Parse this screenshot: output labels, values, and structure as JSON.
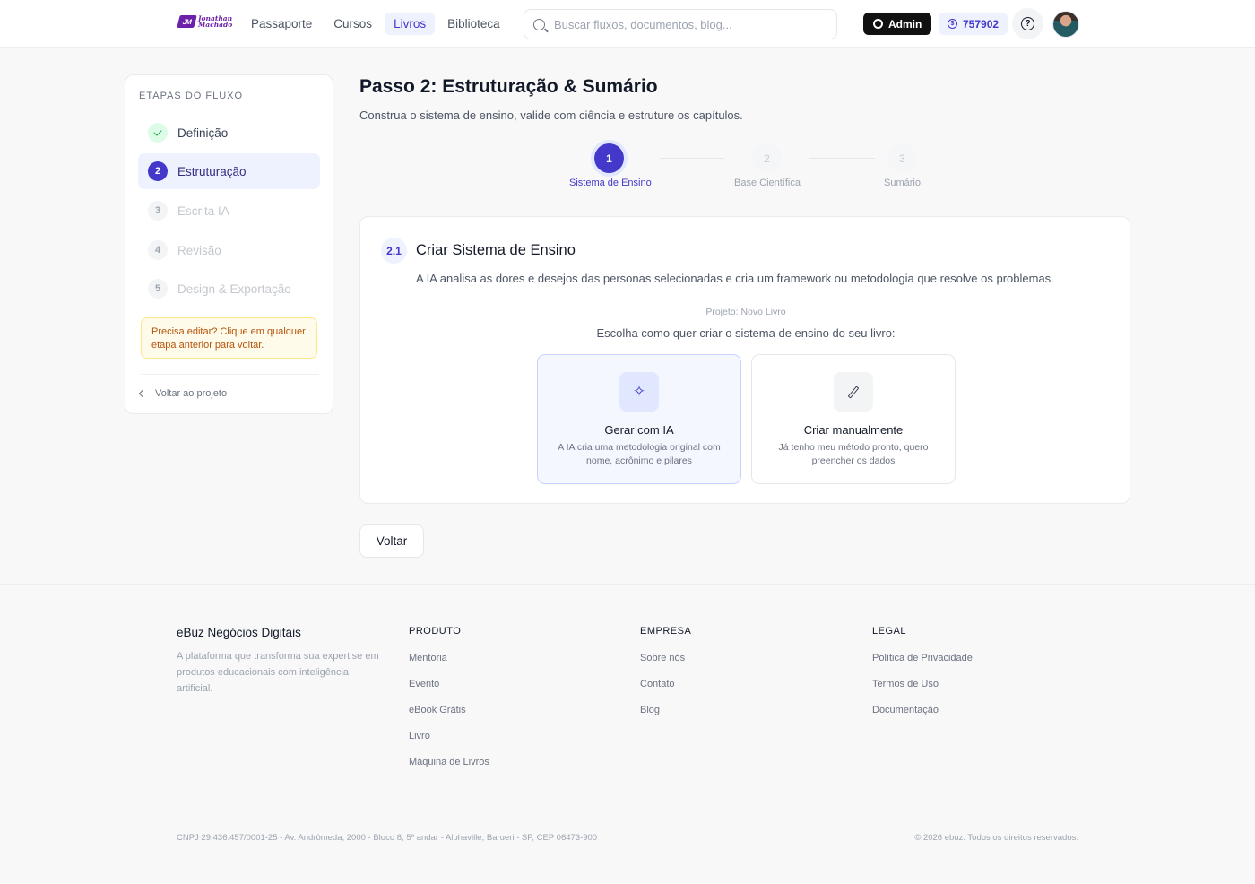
{
  "header": {
    "logo_mark": "JM",
    "logo_text_line1": "Jonathan",
    "logo_text_line2": "Machado",
    "nav": [
      {
        "label": "Passaporte",
        "active": false
      },
      {
        "label": "Cursos",
        "active": false
      },
      {
        "label": "Livros",
        "active": true
      },
      {
        "label": "Biblioteca",
        "active": false
      }
    ],
    "search_placeholder": "Buscar fluxos, documentos, blog...",
    "admin_label": "Admin",
    "credits": "757902",
    "help_glyph": "?"
  },
  "sidebar": {
    "heading": "ETAPAS DO FLUXO",
    "steps": [
      {
        "number": "1",
        "label": "Definição",
        "state": "done"
      },
      {
        "number": "2",
        "label": "Estruturação",
        "state": "active"
      },
      {
        "number": "3",
        "label": "Escrita IA",
        "state": "locked"
      },
      {
        "number": "4",
        "label": "Revisão",
        "state": "locked"
      },
      {
        "number": "5",
        "label": "Design & Exportação",
        "state": "locked"
      }
    ],
    "edit_note": "Precisa editar? Clique em qualquer etapa anterior para voltar.",
    "back_label": "Voltar ao projeto"
  },
  "main": {
    "title": "Passo 2: Estruturação & Sumário",
    "subtitle": "Construa o sistema de ensino, valide com ciência e estruture os capítulos.",
    "stepper": [
      {
        "number": "1",
        "label": "Sistema de Ensino",
        "current": true
      },
      {
        "number": "2",
        "label": "Base Científica",
        "current": false
      },
      {
        "number": "3",
        "label": "Sumário",
        "current": false
      }
    ],
    "section": {
      "badge": "2.1",
      "title": "Criar Sistema de Ensino",
      "description": "A IA analisa as dores e desejos das personas selecionadas e cria um framework ou metodologia que resolve os problemas.",
      "project_line": "Projeto: Novo Livro",
      "choose_line": "Escolha como quer criar o sistema de ensino do seu livro:",
      "options": [
        {
          "icon": "sparkle-icon",
          "glyph": "✧",
          "title": "Gerar com IA",
          "description": "A IA cria uma metodologia original com nome, acrônimo e pilares"
        },
        {
          "icon": "pencil-icon",
          "title": "Criar manualmente",
          "description": "Já tenho meu método pronto, quero preencher os dados"
        }
      ]
    },
    "back_button": "Voltar"
  },
  "footer": {
    "brand": "eBuz Negócios Digitais",
    "description": "A plataforma que transforma sua expertise em produtos educacionais com inteligência artificial.",
    "columns": [
      {
        "heading": "PRODUTO",
        "links": [
          "Mentoria",
          "Evento",
          "eBook Grátis",
          "Livro",
          "Máquina de Livros"
        ]
      },
      {
        "heading": "EMPRESA",
        "links": [
          "Sobre nós",
          "Contato",
          "Blog"
        ]
      },
      {
        "heading": "LEGAL",
        "links": [
          "Política de Privacidade",
          "Termos de Uso",
          "Documentação"
        ]
      }
    ],
    "legal": "CNPJ 29.436.457/0001-25 - Av. Andrômeda, 2000 - Bloco 8, 5º andar - Alphaville, Barueri - SP, CEP 06473-900",
    "copyright": "© 2026 ebuz. Todos os direitos reservados."
  },
  "colors": {
    "accent": "#4338ca",
    "accent_soft": "#eef2ff",
    "success": "#16a34a",
    "warning_text": "#b45309",
    "warning_bg": "#fffbeb"
  }
}
